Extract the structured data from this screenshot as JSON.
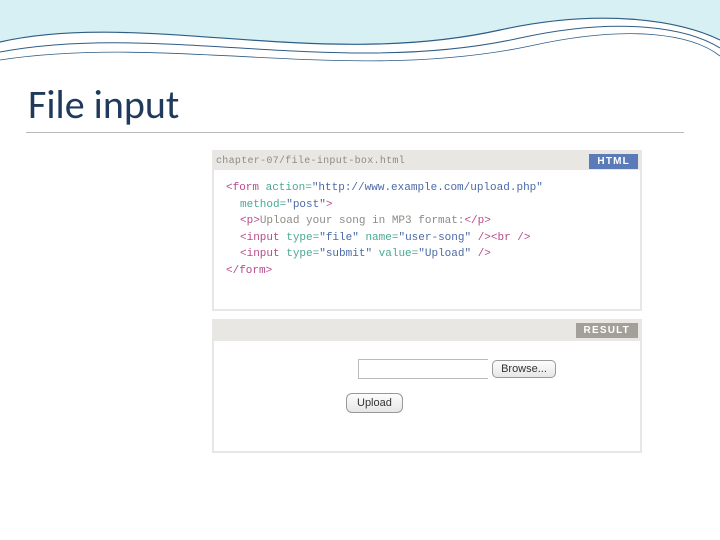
{
  "slide": {
    "title": "File input"
  },
  "html_panel": {
    "path": "chapter-07/file-input-box.html",
    "badge": "HTML",
    "code": {
      "l1a": "<form ",
      "l1b": "action=",
      "l1c": "\"http://www.example.com/upload.php\"",
      "l2a": "method=",
      "l2b": "\"post\"",
      "l2c": ">",
      "l3a": "<p>",
      "l3b": "Upload your song in MP3 format:",
      "l3c": "</p>",
      "l4a": "<input ",
      "l4b": "type=",
      "l4c": "\"file\" ",
      "l4d": "name=",
      "l4e": "\"user-song\" ",
      "l4f": "/><br />",
      "l5a": "<input ",
      "l5b": "type=",
      "l5c": "\"submit\" ",
      "l5d": "value=",
      "l5e": "\"Upload\" ",
      "l5f": "/>",
      "l6": "</form>"
    }
  },
  "result_panel": {
    "badge": "RESULT",
    "browse_label": "Browse...",
    "upload_label": "Upload"
  }
}
